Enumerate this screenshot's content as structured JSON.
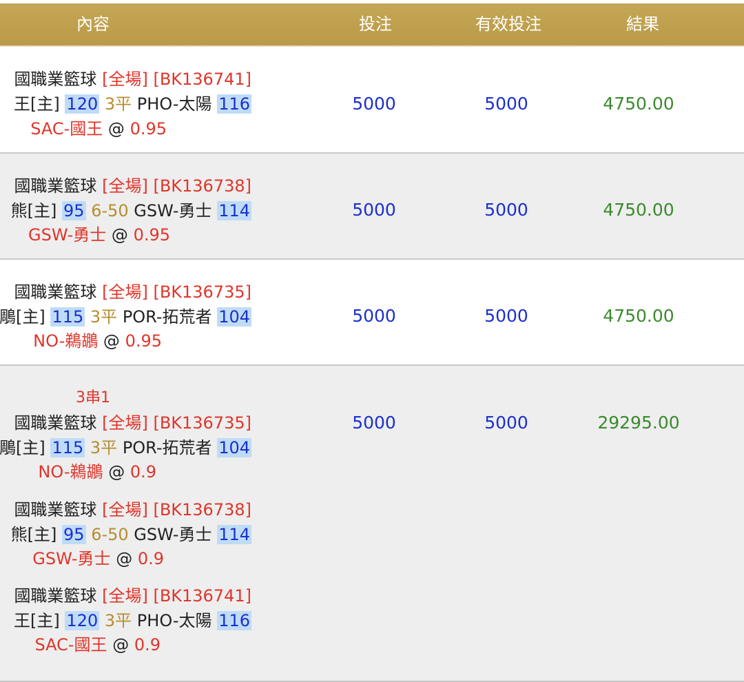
{
  "header": {
    "content": "內容",
    "bet": "投注",
    "valid_bet": "有效投注",
    "result": "結果"
  },
  "rows": [
    {
      "league": "國職業籃球",
      "period": "[全場]",
      "code": "[BK136741]",
      "home": "王[主]",
      "home_score": "120",
      "handicap": "3平",
      "away": "PHO-太陽",
      "away_score": "116",
      "pick_team": "SAC-國王",
      "pick_at": "@",
      "odds": "0.95",
      "bet": "5000",
      "valid_bet": "5000",
      "result": "4750.00"
    },
    {
      "league": "國職業籃球",
      "period": "[全場]",
      "code": "[BK136738]",
      "home": "熊[主]",
      "home_score": "95",
      "handicap": "6-50",
      "away": "GSW-勇士",
      "away_score": "114",
      "pick_team": "GSW-勇士",
      "pick_at": "@",
      "odds": "0.95",
      "bet": "5000",
      "valid_bet": "5000",
      "result": "4750.00"
    },
    {
      "league": "國職業籃球",
      "period": "[全場]",
      "code": "[BK136735]",
      "home": "鵰[主]",
      "home_score": "115",
      "handicap": "3平",
      "away": "POR-拓荒者",
      "away_score": "104",
      "pick_team": "NO-鵜鶘",
      "pick_at": "@",
      "odds": "0.95",
      "bet": "5000",
      "valid_bet": "5000",
      "result": "4750.00"
    }
  ],
  "parlay": {
    "label": "3串1",
    "bet": "5000",
    "valid_bet": "5000",
    "result": "29295.00",
    "legs": [
      {
        "league": "國職業籃球",
        "period": "[全場]",
        "code": "[BK136735]",
        "home": "鵰[主]",
        "home_score": "115",
        "handicap": "3平",
        "away": "POR-拓荒者",
        "away_score": "104",
        "pick_team": "NO-鵜鶘",
        "pick_at": "@",
        "odds": "0.9"
      },
      {
        "league": "國職業籃球",
        "period": "[全場]",
        "code": "[BK136738]",
        "home": "熊[主]",
        "home_score": "95",
        "handicap": "6-50",
        "away": "GSW-勇士",
        "away_score": "114",
        "pick_team": "GSW-勇士",
        "pick_at": "@",
        "odds": "0.9"
      },
      {
        "league": "國職業籃球",
        "period": "[全場]",
        "code": "[BK136741]",
        "home": "王[主]",
        "home_score": "120",
        "handicap": "3平",
        "away": "PHO-太陽",
        "away_score": "116",
        "pick_team": "SAC-國王",
        "pick_at": "@",
        "odds": "0.9"
      }
    ]
  },
  "colors": {
    "header_gold": "#bfa04e",
    "red": "#e0352b",
    "blue": "#1a2fcf",
    "green": "#3a8a2c",
    "handicap_gold": "#b68d2e",
    "highlight": "#bfdcf7"
  }
}
